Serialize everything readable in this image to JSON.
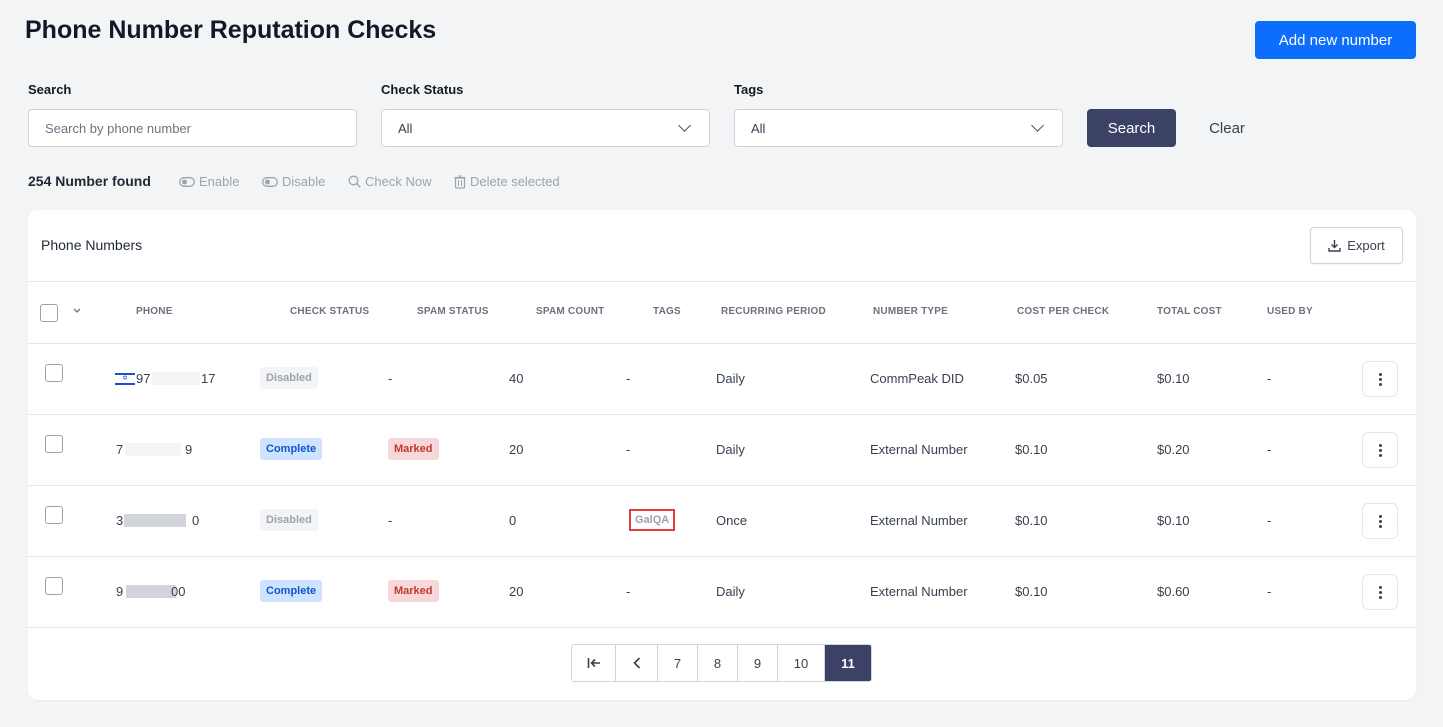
{
  "page": {
    "title": "Phone Number Reputation Checks",
    "add_button": "Add new number"
  },
  "filters": {
    "search": {
      "label": "Search",
      "placeholder": "Search by phone number",
      "value": ""
    },
    "check_status": {
      "label": "Check Status",
      "value": "All"
    },
    "tags": {
      "label": "Tags",
      "value": "All"
    },
    "search_button": "Search",
    "clear_button": "Clear"
  },
  "summary": {
    "found": "254 Number found",
    "actions": {
      "enable": "Enable",
      "disable": "Disable",
      "check_now": "Check Now",
      "delete_selected": "Delete selected"
    }
  },
  "table": {
    "title": "Phone Numbers",
    "export": "Export",
    "columns": [
      "PHONE",
      "CHECK STATUS",
      "SPAM STATUS",
      "SPAM COUNT",
      "TAGS",
      "RECURRING PERIOD",
      "NUMBER TYPE",
      "COST PER CHECK",
      "TOTAL COST",
      "USED BY"
    ],
    "rows": [
      {
        "phone_start": "97",
        "phone_end": "17",
        "check_status": "Disabled",
        "spam_status": "-",
        "spam_count": "40",
        "tags": "-",
        "recurring": "Daily",
        "number_type": "CommPeak DID",
        "cost_per_check": "$0.05",
        "total_cost": "$0.10",
        "used_by": "-"
      },
      {
        "phone_start": "7",
        "phone_end": "9",
        "check_status": "Complete",
        "spam_status": "Marked",
        "spam_count": "20",
        "tags": "-",
        "recurring": "Daily",
        "number_type": "External Number",
        "cost_per_check": "$0.10",
        "total_cost": "$0.20",
        "used_by": "-"
      },
      {
        "phone_start": "3",
        "phone_end": "0",
        "check_status": "Disabled",
        "spam_status": "-",
        "spam_count": "0",
        "tags": "GalQA",
        "recurring": "Once",
        "number_type": "External Number",
        "cost_per_check": "$0.10",
        "total_cost": "$0.10",
        "used_by": "-"
      },
      {
        "phone_start": "9",
        "phone_end": "00",
        "check_status": "Complete",
        "spam_status": "Marked",
        "spam_count": "20",
        "tags": "-",
        "recurring": "Daily",
        "number_type": "External Number",
        "cost_per_check": "$0.10",
        "total_cost": "$0.60",
        "used_by": "-"
      }
    ]
  },
  "pagination": {
    "pages": [
      "7",
      "8",
      "9",
      "10",
      "11"
    ],
    "current": "11"
  },
  "colors": {
    "primary": "#0d6efd",
    "navy": "#3b4266",
    "complete": "#0a58ca",
    "marked": "#c0392b"
  }
}
